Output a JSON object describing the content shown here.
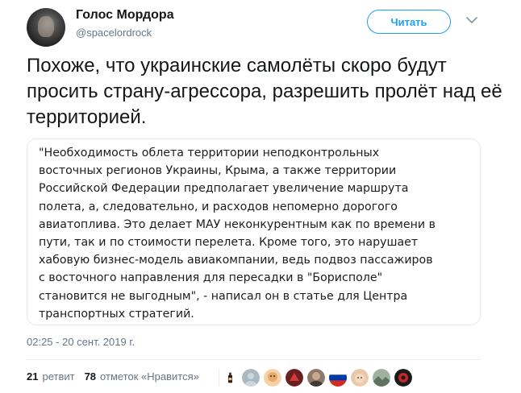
{
  "author": {
    "name": "Голос Мордора",
    "handle": "@spacelordrock"
  },
  "follow_button": {
    "label": "Читать"
  },
  "tweet": {
    "text": "Похоже, что украинские самолёты скоро будут просить страну-агрессора, разрешить пролёт над её территорией."
  },
  "quote": {
    "text": "\"Необходимость облета территории неподконтрольных\nвосточных регионов Украины, Крыма, а также территории\nРоссийской Федерации предполагает увеличение маршрута\nполета, а, следовательно, и расходов непомерно дорогого\nавиатоплива. Это делает МАУ неконкурентным как по времени в\nпути, так и по стоимости перелета. Кроме того, это нарушает\nхабовую бизнес-модель авиакомпании, ведь подвоз пассажиров\nс восточного направления для пересадки в \"Борисполе\"\nстановится не выгодным\", - написал он в статье для Центра\nтранспортных стратегий."
  },
  "timestamp": "02:25 - 20 сент. 2019 г.",
  "stats": {
    "retweets_count": "21",
    "retweets_label": "ретвит",
    "likes_count": "78",
    "likes_label": "отметок «Нравится»"
  },
  "colors": {
    "accent": "#1da1f2",
    "secondary_text": "#657786",
    "border": "#e1e8ed"
  },
  "icons": {
    "chevron": "chevron-down-icon"
  }
}
